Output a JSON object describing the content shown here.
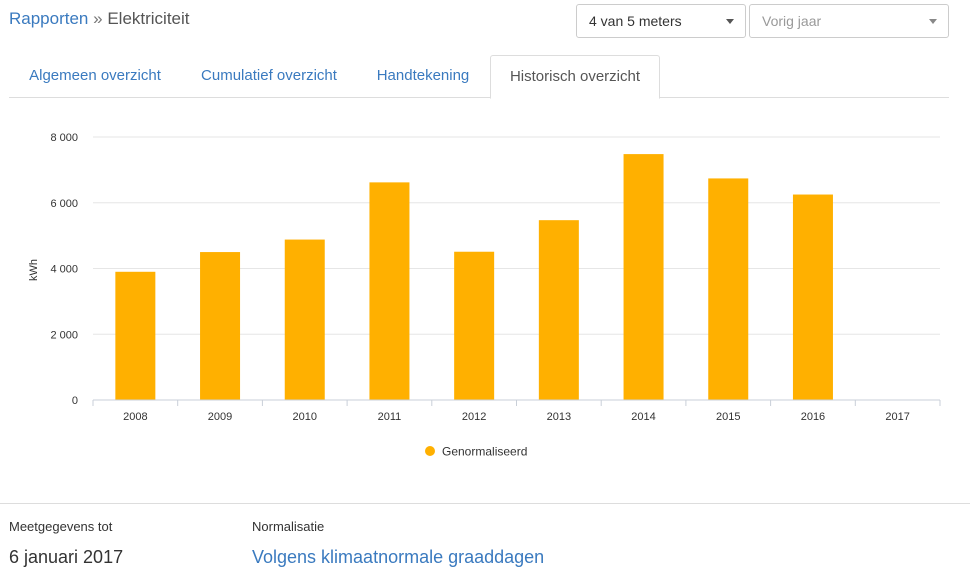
{
  "breadcrumb": {
    "root": "Rapporten",
    "separator": "»",
    "current": "Elektriciteit"
  },
  "meter_select": {
    "value": "4 van 5 meters"
  },
  "period_select": {
    "placeholder": "Vorig jaar"
  },
  "tabs": [
    {
      "label": "Algemeen overzicht",
      "active": false
    },
    {
      "label": "Cumulatief overzicht",
      "active": false
    },
    {
      "label": "Handtekening",
      "active": false
    },
    {
      "label": "Historisch overzicht",
      "active": true
    }
  ],
  "chart_data": {
    "type": "bar",
    "categories": [
      "2008",
      "2009",
      "2010",
      "2011",
      "2012",
      "2013",
      "2014",
      "2015",
      "2016",
      "2017"
    ],
    "series": [
      {
        "name": "Genormaliseerd",
        "values": [
          3900,
          4500,
          4880,
          6620,
          4510,
          5470,
          7480,
          6740,
          6250,
          0
        ],
        "color": "#ffb000"
      }
    ],
    "ylabel": "kWh",
    "ylim": [
      0,
      8000
    ],
    "yticks": [
      0,
      2000,
      4000,
      6000,
      8000
    ],
    "ytick_labels": [
      "0",
      "2 000",
      "4 000",
      "6 000",
      "8 000"
    ],
    "grid": true,
    "legend": "bottom-center"
  },
  "info": {
    "measure_label": "Meetgegevens tot",
    "measure_value": "6 januari 2017",
    "norm_label": "Normalisatie",
    "norm_value": "Volgens klimaatnormale graaddagen"
  }
}
